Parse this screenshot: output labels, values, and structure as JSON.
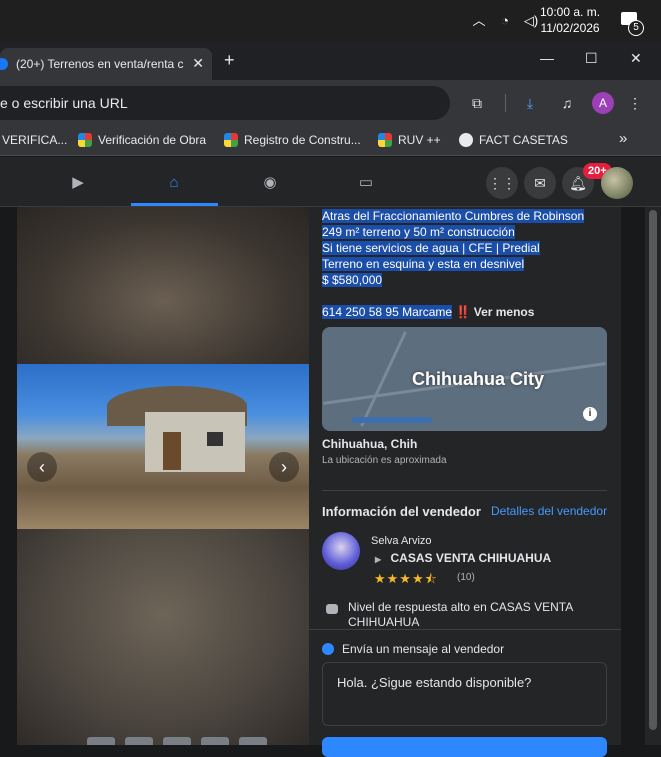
{
  "taskbar": {
    "time": "10:00 a. m.",
    "date": "11/02/2026",
    "notification_count": "5"
  },
  "browser": {
    "tab_title": "(20+) Terrenos en venta/renta c",
    "omnibox_text": "e o escribir una URL",
    "profile_letter": "A",
    "bookmarks": [
      {
        "label": "VERIFICA..."
      },
      {
        "label": "Verificación de Obra"
      },
      {
        "label": "Registro de Constru..."
      },
      {
        "label": "RUV ++"
      },
      {
        "label": "FACT CASETAS"
      }
    ],
    "bookmarks_overflow": "»"
  },
  "fb_nav": {
    "notification_badge": "20+"
  },
  "listing": {
    "description_lines": [
      "Atras del Fraccionamiento Cumbres de Robinson",
      "249 m² terreno y 50 m² construcción",
      "Si tiene servicios de agua | CFE | Predial",
      "Terreno en esquina y esta en desnivel",
      "$ $580,000"
    ],
    "phone_text": "614 250 58 95 Marcame",
    "exclaim": "‼️",
    "see_less": "Ver menos",
    "map_city": "Chihuahua City",
    "location": "Chihuahua, Chih",
    "location_note": "La ubicación es aproximada"
  },
  "seller": {
    "heading": "Información del vendedor",
    "details_link": "Detalles del vendedor",
    "name": "Selva Arvizo",
    "group": "CASAS VENTA CHIHUAHUA",
    "rating": 4.5,
    "stars_display": "★★★★⯪",
    "review_count": "(10)",
    "response_text": "Nivel de respuesta alto en CASAS VENTA CHIHUAHUA"
  },
  "message": {
    "heading": "Envía un mensaje al vendedor",
    "input_value": "Hola. ¿Sigue estando disponible?"
  },
  "colors": {
    "accent": "#2d88ff",
    "highlight": "#1b4ea8",
    "badge": "#e41e3f",
    "star": "#f7b928"
  }
}
